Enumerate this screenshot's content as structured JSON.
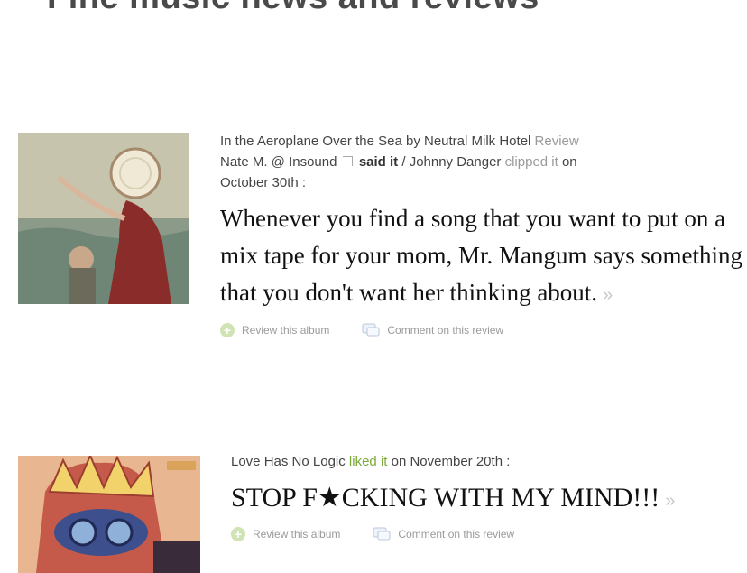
{
  "page": {
    "heading": "Fine music news and reviews"
  },
  "entries": [
    {
      "album": "In the Aeroplane Over the Sea",
      "by": "by",
      "artist": "Neutral Milk Hotel",
      "type": "Review",
      "author": "Nate M. @ Insound",
      "verb": "said it",
      "sep": "/",
      "clipper": "Johnny Danger",
      "clipped": "clipped it",
      "on": "on",
      "date": "October 30th :",
      "quote": "Whenever you find a song that you want to put on a mix tape for your mom, Mr. Mangum says something that you don't want her thinking about.",
      "more": "»",
      "review_action": "Review this album",
      "comment_action": "Comment on this review"
    },
    {
      "user": "Love Has No Logic",
      "liked": "liked it",
      "date": "on November 20th :",
      "quote_start": "STOP F",
      "quote_censor": "★",
      "quote_end": "CKING WITH MY MIND!!!",
      "more": "»",
      "review_action": "Review this album",
      "comment_action": "Comment on this review"
    }
  ],
  "colors": {
    "accent_green": "#7cab3a",
    "muted": "#9a9a9a"
  },
  "icons": [
    "plus-circle-icon",
    "comment-icon",
    "external-link-icon"
  ]
}
